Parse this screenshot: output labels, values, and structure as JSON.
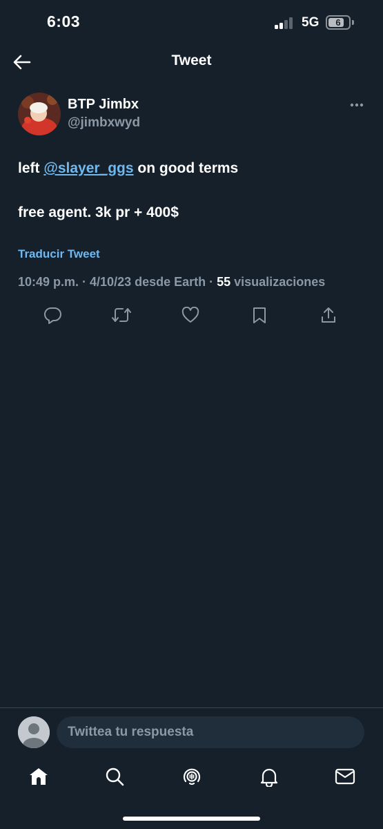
{
  "status_bar": {
    "time": "6:03",
    "network": "5G",
    "battery_level": "6"
  },
  "header": {
    "title": "Tweet",
    "back_icon": "arrow-left-icon"
  },
  "tweet": {
    "author": {
      "display_name": "BTP Jimbx",
      "handle": "@jimbxwyd"
    },
    "more_icon": "more-horizontal-icon",
    "line1_before": "left ",
    "mention": "@slayer_ggs",
    "line1_after": " on good terms",
    "line2": "free agent. 3k pr + 400$",
    "translate_label": "Traducir Tweet",
    "timestamp": "10:49 p.m. · 4/10/23 desde Earth · ",
    "views_count": "55",
    "views_label": " visualizaciones",
    "actions": [
      "reply-icon",
      "retweet-icon",
      "like-icon",
      "bookmark-icon",
      "share-icon"
    ]
  },
  "reply": {
    "placeholder": "Twittea tu respuesta"
  },
  "tab_bar": {
    "items": [
      "home-icon",
      "search-icon",
      "spaces-icon",
      "notifications-icon",
      "messages-icon"
    ]
  },
  "colors": {
    "background": "#15202b",
    "accent": "#6fb9f0",
    "secondary_text": "#8b98a5",
    "divider": "#38444d"
  }
}
